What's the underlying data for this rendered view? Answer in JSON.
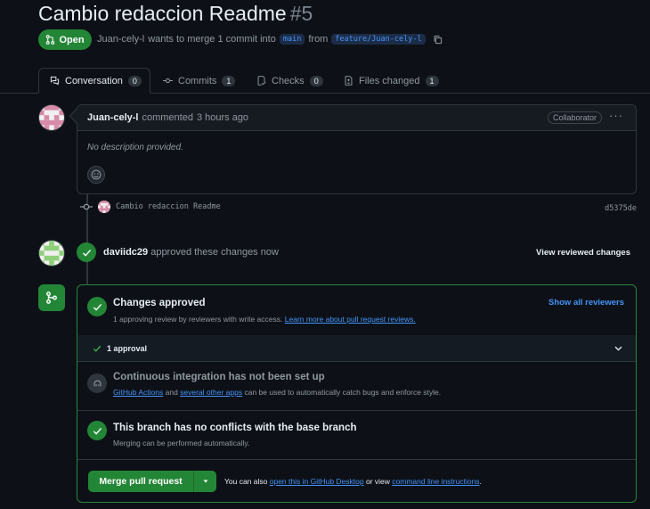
{
  "pr": {
    "title": "Cambio redaccion Readme",
    "number": "#5",
    "state": "Open",
    "author": "Juan-cely-l",
    "meta_text": "wants to merge 1 commit into",
    "base_branch": "main",
    "from_text": "from",
    "head_branch": "feature/Juan-cely-l"
  },
  "tabs": [
    {
      "label": "Conversation",
      "count": "0",
      "icon": "comment-discussion-icon"
    },
    {
      "label": "Commits",
      "count": "1",
      "icon": "git-commit-icon"
    },
    {
      "label": "Checks",
      "count": "0",
      "icon": "checklist-icon"
    },
    {
      "label": "Files changed",
      "count": "1",
      "icon": "file-diff-icon"
    }
  ],
  "comment": {
    "author": "Juan-cely-l",
    "action": "commented",
    "time": "3 hours ago",
    "badge": "Collaborator",
    "body": "No description provided."
  },
  "commit": {
    "message": "Cambio redaccion Readme",
    "sha": "d5375de"
  },
  "review": {
    "reviewer": "daviidc29",
    "text": "approved these changes",
    "time": "now",
    "view_label": "View reviewed changes"
  },
  "merge_box": {
    "approved_title": "Changes approved",
    "approved_sub": "1 approving review by reviewers with write access.",
    "approved_link": "Learn more about pull request reviews.",
    "show_all": "Show all reviewers",
    "approval_count": "1 approval",
    "ci_title": "Continuous integration has not been set up",
    "ci_link1": "GitHub Actions",
    "ci_and": "and",
    "ci_link2": "several other apps",
    "ci_rest": "can be used to automatically catch bugs and enforce style.",
    "conflict_title": "This branch has no conflicts with the base branch",
    "conflict_sub": "Merging can be performed automatically.",
    "merge_button": "Merge pull request",
    "also_text": "You can also",
    "desktop_link": "open this in GitHub Desktop",
    "or_view": "or view",
    "cli_link": "command line instructions",
    "period": "."
  },
  "colors": {
    "background": "#0d1117",
    "success": "#238636",
    "link": "#4493f8",
    "border": "#30363d"
  }
}
